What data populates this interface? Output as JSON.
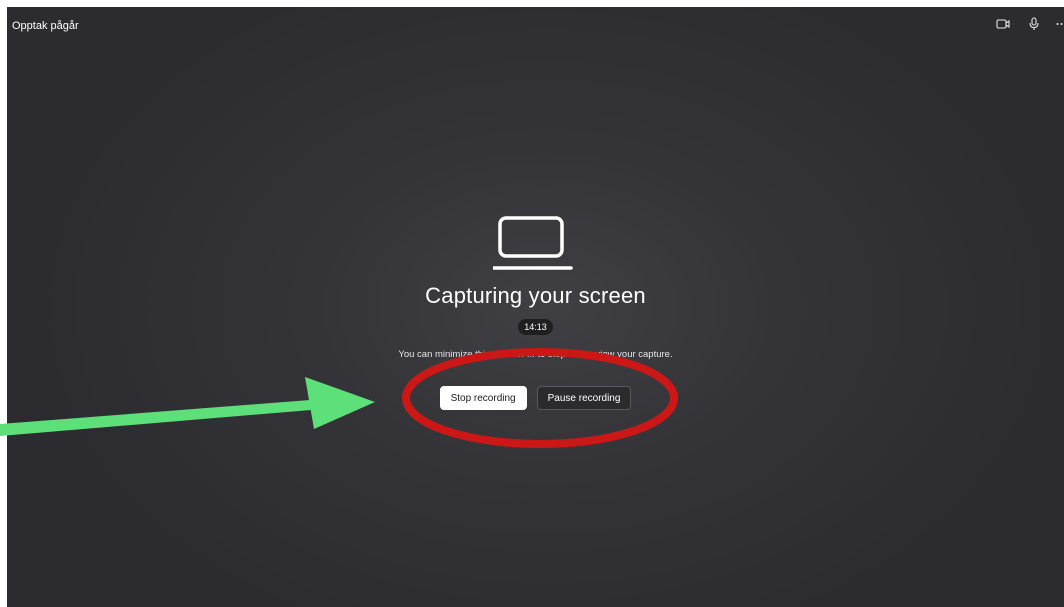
{
  "window": {
    "title": "Opptak pågår"
  },
  "toolbar_icons": [
    "camera-icon",
    "microphone-icon",
    "more-icon"
  ],
  "main": {
    "icon": "laptop-icon",
    "heading": "Capturing your screen",
    "timer": "14:13",
    "description": "You can minimize this window ... to stop and review your capture."
  },
  "buttons": {
    "stop": "Stop recording",
    "pause": "Pause recording"
  },
  "annotations": {
    "arrow_color": "#5de07a",
    "ellipse_color": "#cc1717"
  }
}
